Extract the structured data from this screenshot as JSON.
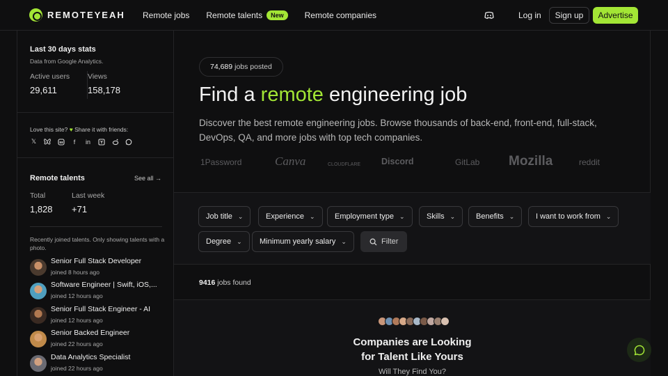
{
  "header": {
    "logo_text": "REMOTEYEAH",
    "nav": [
      {
        "label": "Remote jobs"
      },
      {
        "label": "Remote talents",
        "badge": "New"
      },
      {
        "label": "Remote companies"
      }
    ],
    "discord_icon": "discord-icon",
    "login_label": "Log in",
    "signup_label": "Sign up",
    "advertise_label": "Advertise",
    "accent_color": "#a3e635"
  },
  "sidebar": {
    "stats": {
      "title": "Last 30 days stats",
      "subtitle": "Data from Google Analytics.",
      "active_users_label": "Active users",
      "active_users_value": "29,611",
      "views_label": "Views",
      "views_value": "158,178"
    },
    "share": {
      "text_before": "Love this site?",
      "text_after": "Share it with friends:",
      "icons": [
        "x-icon",
        "bluesky-icon",
        "mastodon-icon",
        "facebook-icon",
        "linkedin-icon",
        "ycombinator-icon",
        "reddit-icon",
        "whatsapp-icon"
      ]
    },
    "talents": {
      "title": "Remote talents",
      "see_all": "See all →",
      "total_label": "Total",
      "total_value": "1,828",
      "last_week_label": "Last week",
      "last_week_value": "+71",
      "note": "Recently joined talents. Only showing talents with a photo.",
      "items": [
        {
          "name": "Senior Full Stack Developer",
          "joined": "joined 8 hours ago"
        },
        {
          "name": "Software Engineer | Swift, iOS,...",
          "joined": "joined 12 hours ago"
        },
        {
          "name": "Senior Full Stack Engineer - AI",
          "joined": "joined 12 hours ago"
        },
        {
          "name": "Senior Backed Engineer",
          "joined": "joined 22 hours ago"
        },
        {
          "name": "Data Analytics Specialist",
          "joined": "joined 22 hours ago"
        }
      ]
    }
  },
  "main": {
    "jobs_posted_count": "74,689",
    "jobs_posted_label": "jobs posted",
    "hero_before": "Find a",
    "hero_accent": "remote",
    "hero_after": "engineering job",
    "hero_desc": "Discover the best remote engineering jobs. Browse thousands of back-end, front-end, full-stack, DevOps, QA, and more jobs with top tech companies.",
    "company_logos": [
      "1Password",
      "Canva",
      "CLOUDFLARE",
      "Discord",
      "GitLab",
      "Mozilla",
      "reddit"
    ],
    "filters": [
      "Job title",
      "Experience",
      "Employment type",
      "Skills",
      "Benefits",
      "I want to work from",
      "Degree",
      "Minimum yearly salary"
    ],
    "filter_button": "Filter",
    "jobs_found_count": "9416",
    "jobs_found_label": "jobs found",
    "cta_line1": "Companies are Looking",
    "cta_line2": "for Talent Like Yours",
    "cta_sub": "Will They Find You?"
  },
  "chat_icon": "chat-bubble-icon"
}
